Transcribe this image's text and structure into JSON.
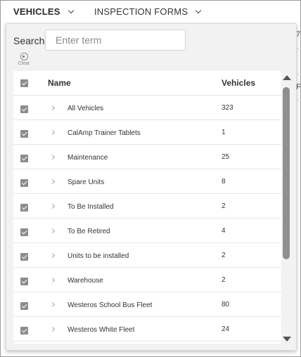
{
  "nav": {
    "vehicles_label": "VEHICLES",
    "forms_label": "INSPECTION FORMS"
  },
  "background": {
    "char_top": "7",
    "char_mid": "F"
  },
  "search": {
    "label": "Search:",
    "placeholder": "Enter term",
    "value": ""
  },
  "clear": {
    "label": "Clear"
  },
  "table": {
    "headers": {
      "name": "Name",
      "vehicles": "Vehicles"
    },
    "rows": [
      {
        "name": "All Vehicles",
        "count": "323",
        "checked": true
      },
      {
        "name": "CalAmp Trainer Tablets",
        "count": "1",
        "checked": true
      },
      {
        "name": "Maintenance",
        "count": "25",
        "checked": true
      },
      {
        "name": "Spare Units",
        "count": "8",
        "checked": true
      },
      {
        "name": "To Be Installed",
        "count": "2",
        "checked": true
      },
      {
        "name": "To Be Retired",
        "count": "4",
        "checked": true
      },
      {
        "name": "Units to be installed",
        "count": "2",
        "checked": true
      },
      {
        "name": "Warehouse",
        "count": "2",
        "checked": true
      },
      {
        "name": "Westeros School Bus Fleet",
        "count": "80",
        "checked": true
      },
      {
        "name": "Westeros White Fleet",
        "count": "24",
        "checked": true
      }
    ]
  },
  "colors": {
    "checkbox": "#8c8c8c",
    "panel_bg": "#f2f2f2",
    "scroll_thumb": "#8f8f8f"
  },
  "icons": {
    "nav_dropdown": "chevron-down-icon",
    "row_expand": "chevron-right-icon",
    "clear": "clear-circle-icon",
    "checkbox": "checkbox-checked-icon"
  }
}
